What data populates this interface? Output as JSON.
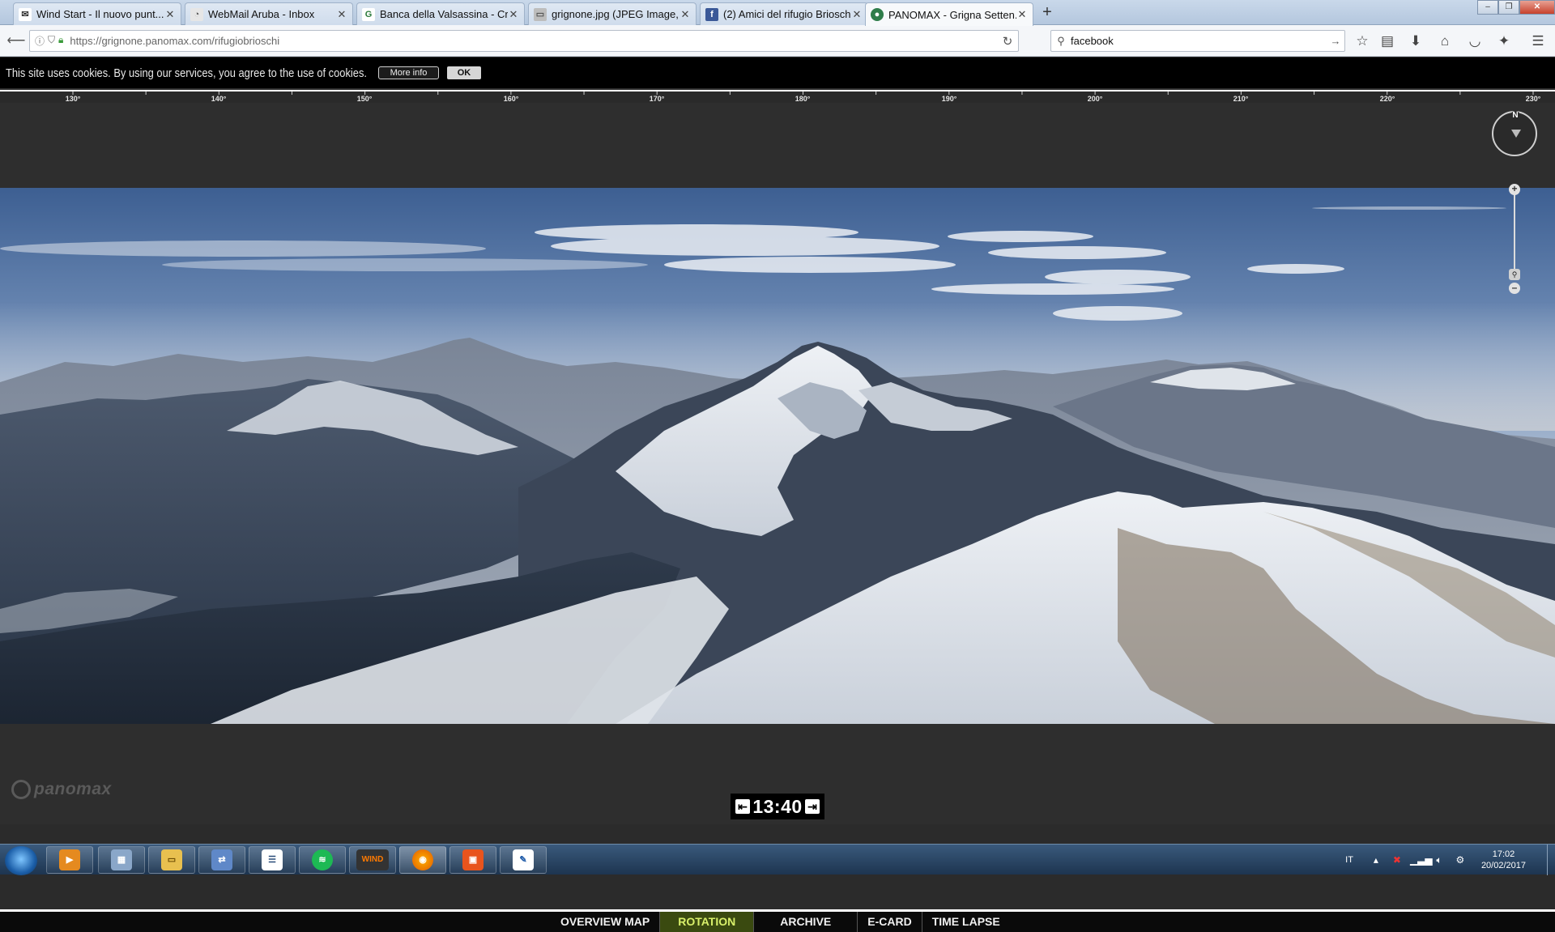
{
  "browser": {
    "tabs": [
      {
        "title": "Wind Start - Il nuovo punt...",
        "favicon": "wind-favicon-icon"
      },
      {
        "title": "WebMail Aruba - Inbox",
        "favicon": "aruba-favicon-icon"
      },
      {
        "title": "Banca della Valsassina - Cr...",
        "favicon": "bank-favicon-icon"
      },
      {
        "title": "grignone.jpg (JPEG Image, ...",
        "favicon": "image-favicon-icon"
      },
      {
        "title": "(2) Amici del rifugio Brioschi",
        "favicon": "facebook-favicon-icon"
      },
      {
        "title": "PANOMAX - Grigna Setten...",
        "favicon": "panomax-favicon-icon"
      }
    ],
    "active_tab": 5,
    "url": "https://grignone.panomax.com/rifugiobrioschi",
    "search_value": "facebook"
  },
  "cookie_bar": {
    "text": "This site uses cookies. By using our services, you agree to the use of cookies.",
    "more_info": "More info",
    "ok": "OK"
  },
  "viewer": {
    "ruler_labels": [
      "130°",
      "140°",
      "150°",
      "160°",
      "170°",
      "180°",
      "190°",
      "200°",
      "210°",
      "220°",
      "230°"
    ],
    "compass_label": "N",
    "logo_text": "panomax",
    "time": "13:40",
    "nav": [
      "OVERVIEW MAP",
      "ROTATION",
      "ARCHIVE",
      "E-CARD",
      "TIME LAPSE"
    ],
    "active_nav": "ROTATION"
  },
  "taskbar": {
    "apps": [
      "media-player-icon",
      "calculator-icon",
      "file-explorer-icon",
      "network-icon",
      "chat-icon",
      "spotify-icon",
      "wind-icon",
      "firefox-icon",
      "office-icon",
      "notepad-icon"
    ],
    "wind_label": "WIND",
    "language": "IT",
    "time": "17:02",
    "date": "20/02/2017"
  },
  "colors": {
    "active_nav_bg": "#3a4a10",
    "active_nav_text": "#d8f06a",
    "viewer_bg": "#2e2e2e"
  }
}
